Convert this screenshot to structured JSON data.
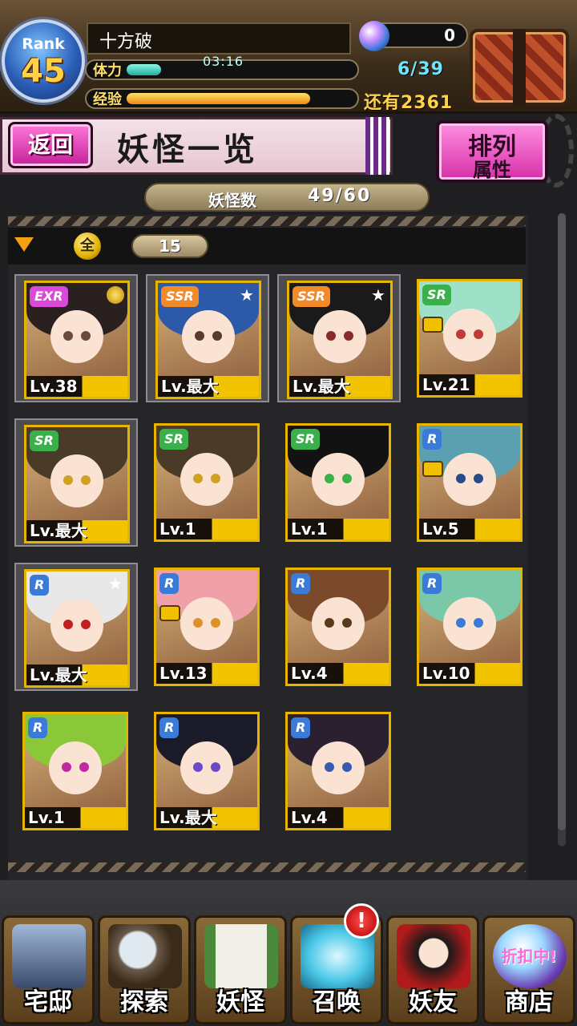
{
  "status": {
    "rank_label": "Rank",
    "rank_value": "45",
    "player_name": "十方破",
    "stamina_label": "体力",
    "stamina_timer": "03:16",
    "stamina_count": "6/39",
    "stamina_fraction": 0.15,
    "exp_label": "经验",
    "exp_fraction": 0.8,
    "exp_remaining": "还有2361",
    "orb_count": "0"
  },
  "header": {
    "back_label": "返回",
    "title": "妖怪一览",
    "sort_line1": "排列",
    "sort_line2": "属性"
  },
  "count": {
    "label": "妖怪数",
    "value": "49/60"
  },
  "filter": {
    "element_glyph": "全",
    "value": "15"
  },
  "cards": [
    {
      "rarity": "EXR",
      "level": "Lv.38",
      "framed": true,
      "star": false,
      "medal": true,
      "lock": false,
      "hair": "#2a2020",
      "eye": "#6a4a3a",
      "rarity_color": "#d94ad9"
    },
    {
      "rarity": "SSR",
      "level": "Lv.最大",
      "framed": true,
      "star": true,
      "lock": false,
      "hair": "#2c5aa8",
      "eye": "#5a3a2a",
      "rarity_color": "#f28a2a"
    },
    {
      "rarity": "SSR",
      "level": "Lv.最大",
      "framed": true,
      "star": true,
      "lock": false,
      "hair": "#1a1a1a",
      "eye": "#8a2a2a",
      "rarity_color": "#f28a2a"
    },
    {
      "rarity": "SR",
      "level": "Lv.21",
      "framed": false,
      "star": false,
      "lock": true,
      "hair": "#9fe0c8",
      "eye": "#c03a3a",
      "rarity_color": "#3ab04a"
    },
    {
      "rarity": "SR",
      "level": "Lv.最大",
      "framed": true,
      "star": false,
      "lock": false,
      "hair": "#4a3a28",
      "eye": "#d0a020",
      "rarity_color": "#3ab04a"
    },
    {
      "rarity": "SR",
      "level": "Lv.1",
      "framed": false,
      "star": false,
      "lock": false,
      "hair": "#4a3a28",
      "eye": "#d0a020",
      "rarity_color": "#3ab04a"
    },
    {
      "rarity": "SR",
      "level": "Lv.1",
      "framed": false,
      "star": false,
      "lock": false,
      "hair": "#121212",
      "eye": "#3ab04a",
      "rarity_color": "#3ab04a"
    },
    {
      "rarity": "R",
      "level": "Lv.5",
      "framed": false,
      "star": false,
      "lock": true,
      "hair": "#5aa0b0",
      "eye": "#2a4a8a",
      "rarity_color": "#3a7ad8"
    },
    {
      "rarity": "R",
      "level": "Lv.最大",
      "framed": true,
      "star": true,
      "lock": false,
      "hair": "#e8e8e8",
      "eye": "#c02020",
      "rarity_color": "#3a7ad8"
    },
    {
      "rarity": "R",
      "level": "Lv.13",
      "framed": false,
      "star": false,
      "lock": true,
      "hair": "#f0a0a8",
      "eye": "#e0902a",
      "rarity_color": "#3a7ad8"
    },
    {
      "rarity": "R",
      "level": "Lv.4",
      "framed": false,
      "star": false,
      "lock": false,
      "hair": "#7a4a2a",
      "eye": "#5a3a1a",
      "rarity_color": "#3a7ad8"
    },
    {
      "rarity": "R",
      "level": "Lv.10",
      "framed": false,
      "star": false,
      "lock": false,
      "hair": "#7ac8a8",
      "eye": "#3a7ad8",
      "rarity_color": "#3a7ad8"
    },
    {
      "rarity": "R",
      "level": "Lv.1",
      "framed": false,
      "star": false,
      "lock": false,
      "hair": "#8ac83a",
      "eye": "#c02aa0",
      "rarity_color": "#3a7ad8"
    },
    {
      "rarity": "R",
      "level": "Lv.最大",
      "framed": false,
      "star": false,
      "lock": false,
      "hair": "#1a1a28",
      "eye": "#6a4ac8",
      "rarity_color": "#3a7ad8"
    },
    {
      "rarity": "R",
      "level": "Lv.4",
      "framed": false,
      "star": false,
      "lock": false,
      "hair": "#2a2030",
      "eye": "#3a5ab0",
      "rarity_color": "#3a7ad8"
    }
  ],
  "nav": {
    "home": "宅邸",
    "explore": "探索",
    "yokai": "妖怪",
    "summon": "召唤",
    "summon_badge": "!",
    "friends": "妖友",
    "shop": "商店",
    "shop_sale": "折扣中!"
  },
  "icons": {
    "star": "★"
  }
}
